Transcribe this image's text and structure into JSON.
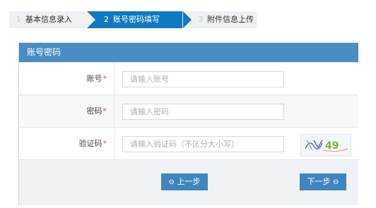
{
  "steps": [
    {
      "num": "1",
      "label": "基本信息录入",
      "active": false
    },
    {
      "num": "2",
      "label": "账号密码填写",
      "active": true
    },
    {
      "num": "3",
      "label": "附件信息上传",
      "active": false
    }
  ],
  "panel": {
    "title": "账号密码"
  },
  "form": {
    "account": {
      "label": "账号",
      "required_mark": "*",
      "placeholder": "请输入账号",
      "value": ""
    },
    "password": {
      "label": "密码",
      "required_mark": "*",
      "placeholder": "请输入密码",
      "value": ""
    },
    "captcha": {
      "label": "验证码",
      "required_mark": "*",
      "placeholder": "请输入验证码（不区分大小写）",
      "value": "",
      "image_text": "49"
    }
  },
  "buttons": {
    "prev_icon": "⊖",
    "prev_label": "上一步",
    "next_label": "下一步",
    "next_icon": "⊖"
  },
  "colors": {
    "active_step": "#1179c2",
    "panel_header": "#4a8dc3",
    "button": "#3f86c1",
    "required": "#d9534f"
  }
}
